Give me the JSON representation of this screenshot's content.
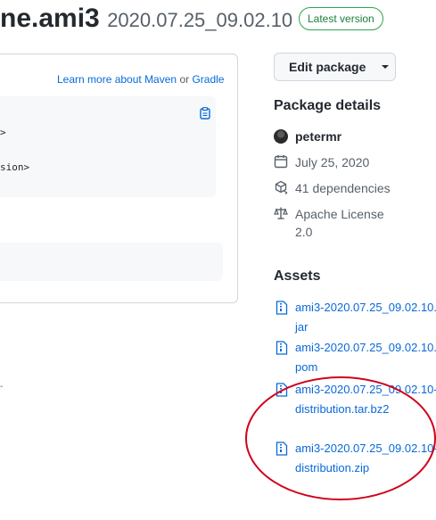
{
  "header": {
    "package_name": "ne.ami3",
    "version": "2020.07.25_09.02.10",
    "badge": "Latest version"
  },
  "install_card": {
    "learn_more": "Learn more about Maven",
    "or": "or",
    "gradle": "Gradle",
    "code_lines": [
      ">",
      "sion>"
    ],
    "stray_glyph": "-"
  },
  "sidebar": {
    "edit_button": "Edit package",
    "details_heading": "Package details",
    "owner": "petermr",
    "date": "July 25, 2020",
    "dependencies": "41 dependencies",
    "license": "Apache License 2.0",
    "assets_heading": "Assets",
    "assets": [
      {
        "name": "ami3-2020.07.25_09.02.10.jar"
      },
      {
        "name": "ami3-2020.07.25_09.02.10.pom"
      },
      {
        "name": "ami3-2020.07.25_09.02.10-distribution.tar.bz2"
      },
      {
        "name": "ami3-2020.07.25_09.02.10-distribution.zip"
      }
    ]
  },
  "colors": {
    "link": "#0969da",
    "badge_green": "#1a7f37",
    "annotation_red": "#d0021b"
  },
  "icons": {
    "clipboard": "clipboard-icon",
    "calendar": "calendar-icon",
    "dependencies": "package-dependencies-icon",
    "license": "law-icon",
    "asset": "file-zip-icon"
  }
}
